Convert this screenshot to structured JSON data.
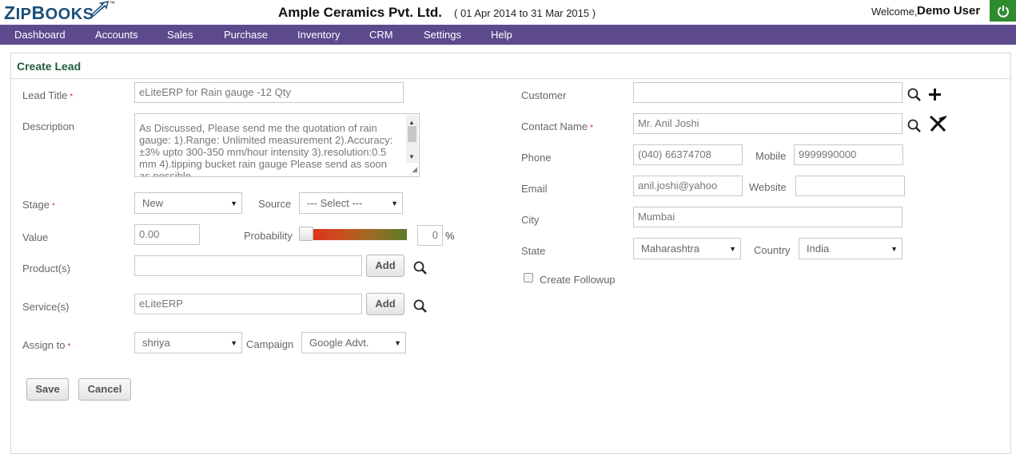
{
  "header": {
    "logo_prefix": "Z",
    "logo_rest": "IP",
    "logo_b": "B",
    "logo_end": "OOKS",
    "logo_tm": "™",
    "company": "Ample Ceramics Pvt. Ltd.",
    "period": "( 01 Apr 2014 to 31 Mar 2015 )",
    "welcome": "Welcome,",
    "user": "Demo User",
    "power_icon": "power-icon",
    "accent_color": "#2e8b2e"
  },
  "nav": {
    "color": "#5c4a8d",
    "items": [
      "Dashboard",
      "Accounts",
      "Sales",
      "Purchase",
      "Inventory",
      "CRM",
      "Settings",
      "Help"
    ]
  },
  "form": {
    "title": "Create Lead",
    "lead_title_label": "Lead Title",
    "lead_title_value": "eLiteERP for Rain gauge -12 Qty",
    "description_label": "Description",
    "description_value": "As Discussed, Please send me the quotation of rain gauge: 1).Range: Unlimited measurement 2).Accuracy: ±3% upto 300-350 mm/hour intensity 3).resolution:0.5 mm 4).tipping bucket rain gauge Please send as soon as possible",
    "stage_label": "Stage",
    "stage_value": "New",
    "source_label": "Source",
    "source_value": "--- Select ---",
    "value_label": "Value",
    "value_value": "0.00",
    "probability_label": "Probability",
    "probability_value": "0",
    "probability_unit": "%",
    "products_label": "Product(s)",
    "products_value": "",
    "services_label": "Service(s)",
    "services_value": "eLiteERP",
    "add_label": "Add",
    "assign_label": "Assign to",
    "assign_value": "shriya",
    "campaign_label": "Campaign",
    "campaign_value": "Google Advt.",
    "save_label": "Save",
    "cancel_label": "Cancel",
    "customer_label": "Customer",
    "customer_value": "",
    "contact_label": "Contact Name",
    "contact_value": "Mr. Anil Joshi",
    "phone_label": "Phone",
    "phone_value": "(040) 66374708",
    "mobile_label": "Mobile",
    "mobile_value": "9999990000",
    "email_label": "Email",
    "email_value": "anil.joshi@yahoo",
    "website_label": "Website",
    "website_value": "",
    "city_label": "City",
    "city_value": "Mumbai",
    "state_label": "State",
    "state_value": "Maharashtra",
    "country_label": "Country",
    "country_value": "India",
    "followup_label": "Create Followup",
    "required_mark": "*",
    "title_color": "#1e5c38"
  }
}
